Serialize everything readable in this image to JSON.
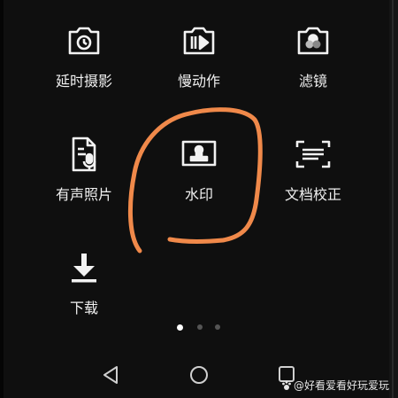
{
  "modes": [
    {
      "label": "延时摄影",
      "icon": "timelapse-icon"
    },
    {
      "label": "慢动作",
      "icon": "slow-motion-icon"
    },
    {
      "label": "滤镜",
      "icon": "filter-icon"
    },
    {
      "label": "有声照片",
      "icon": "audio-photo-icon"
    },
    {
      "label": "水印",
      "icon": "watermark-icon"
    },
    {
      "label": "文档校正",
      "icon": "document-scan-icon"
    },
    {
      "label": "下载",
      "icon": "download-icon"
    }
  ],
  "pagination": {
    "total": 3,
    "current": 1
  },
  "navbar": {
    "back": "back-icon",
    "home": "home-icon",
    "recents": "recents-icon"
  },
  "watermark_text": "@好看爱看好玩爱玩",
  "annotation_color": "#f0894a"
}
